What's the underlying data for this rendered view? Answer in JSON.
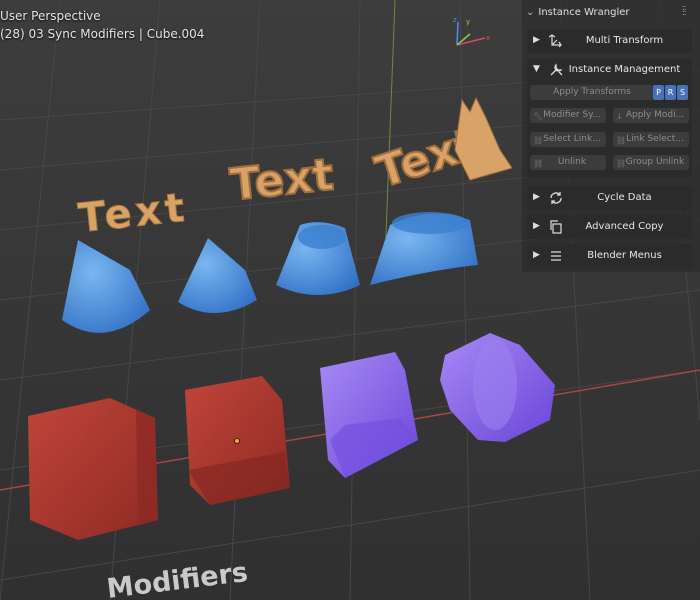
{
  "overlay": {
    "perspective": "User Perspective",
    "context": "(28) 03 Sync Modifiers | Cube.004"
  },
  "gizmo": {
    "x": "x",
    "y": "y",
    "z": "z"
  },
  "scene_text": {
    "text1": "Text",
    "text2": "Text",
    "text3": "Text",
    "bottom": "Modifiers"
  },
  "panel": {
    "title": "Instance Wrangler",
    "sections": {
      "multi_transform": "Multi Transform",
      "instance_management": "Instance Management",
      "cycle_data": "Cycle Data",
      "advanced_copy": "Advanced Copy",
      "blender_menus": "Blender Menus"
    },
    "im": {
      "apply_transforms": "Apply Transforms",
      "p": "P",
      "r": "R",
      "s": "S",
      "modifier_sync": "Modifier Sy...",
      "apply_modifiers": "Apply Modi...",
      "select_linked": "Select Link...",
      "link_selected": "Link Select...",
      "unlink": "Unlink",
      "group_unlink": "Group Unlink"
    }
  },
  "colors": {
    "blue": "#4f95e0",
    "red": "#b23a30",
    "purple": "#8560e8",
    "gold": "#d9a266",
    "accent": "#4772b3"
  }
}
